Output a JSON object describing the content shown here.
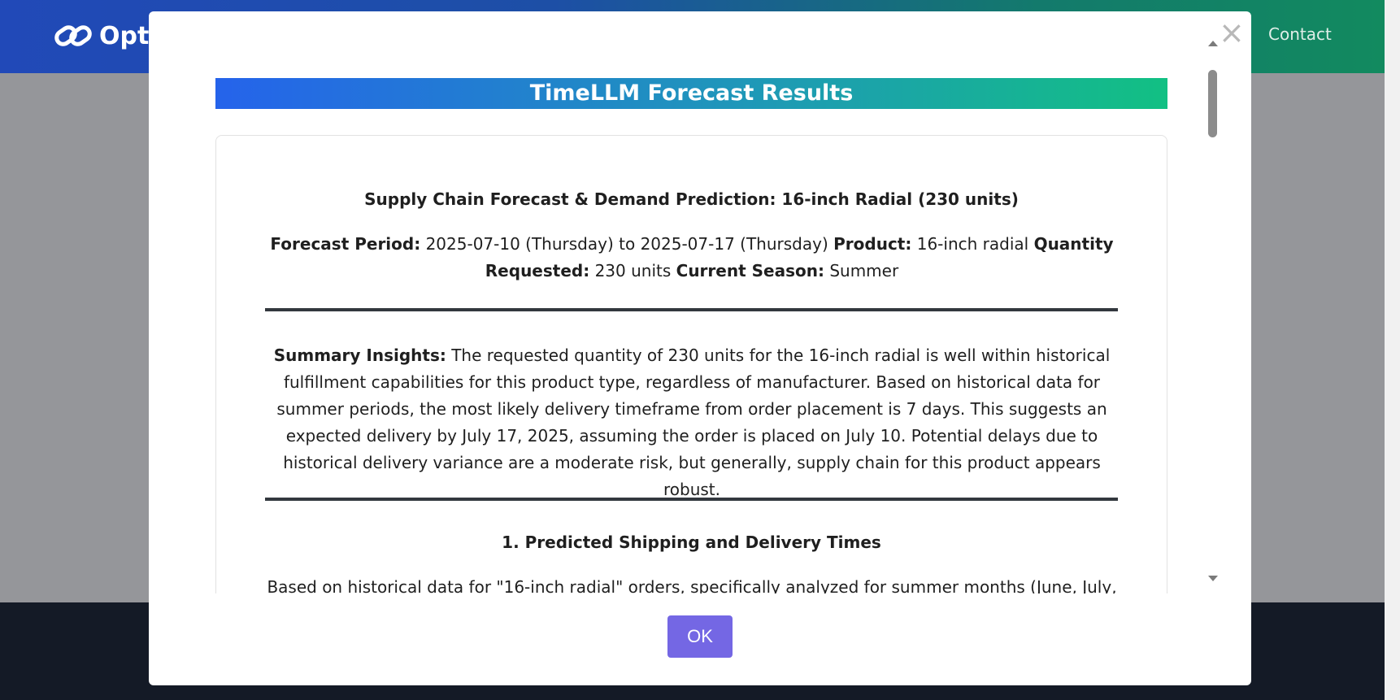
{
  "background": {
    "logo_text": "Opt",
    "nav_contact": "Contact"
  },
  "modal": {
    "close_symbol": "×",
    "title": "TimeLLM Forecast Results",
    "report": {
      "heading": "Supply Chain Forecast & Demand Prediction: 16-inch Radial (230 units)",
      "meta": {
        "forecast_period_label": "Forecast Period:",
        "forecast_period_value": "2025-07-10 (Thursday) to 2025-07-17 (Thursday)",
        "product_label": "Product:",
        "product_value": "16-inch radial",
        "quantity_label": "Quantity Requested:",
        "quantity_value": "230 units",
        "season_label": "Current Season:",
        "season_value": "Summer"
      },
      "summary_label": "Summary Insights:",
      "summary_text": "The requested quantity of 230 units for the 16-inch radial is well within historical fulfillment capabilities for this product type, regardless of manufacturer. Based on historical data for summer periods, the most likely delivery timeframe from order placement is 7 days. This suggests an expected delivery by July 17, 2025, assuming the order is placed on July 10. Potential delays due to historical delivery variance are a moderate risk, but generally, supply chain for this product appears robust.",
      "section1_heading": "1. Predicted Shipping and Delivery Times",
      "section1_text": "Based on historical data for \"16-inch radial\" orders, specifically analyzed for summer months (June, July,"
    },
    "ok_label": "OK"
  },
  "colors": {
    "header_start": "#2149b8",
    "header_end": "#128a5f",
    "title_gradient_start": "#2563eb",
    "title_gradient_end": "#12c083",
    "ok_button": "#7467e4",
    "footer": "#141a26"
  }
}
